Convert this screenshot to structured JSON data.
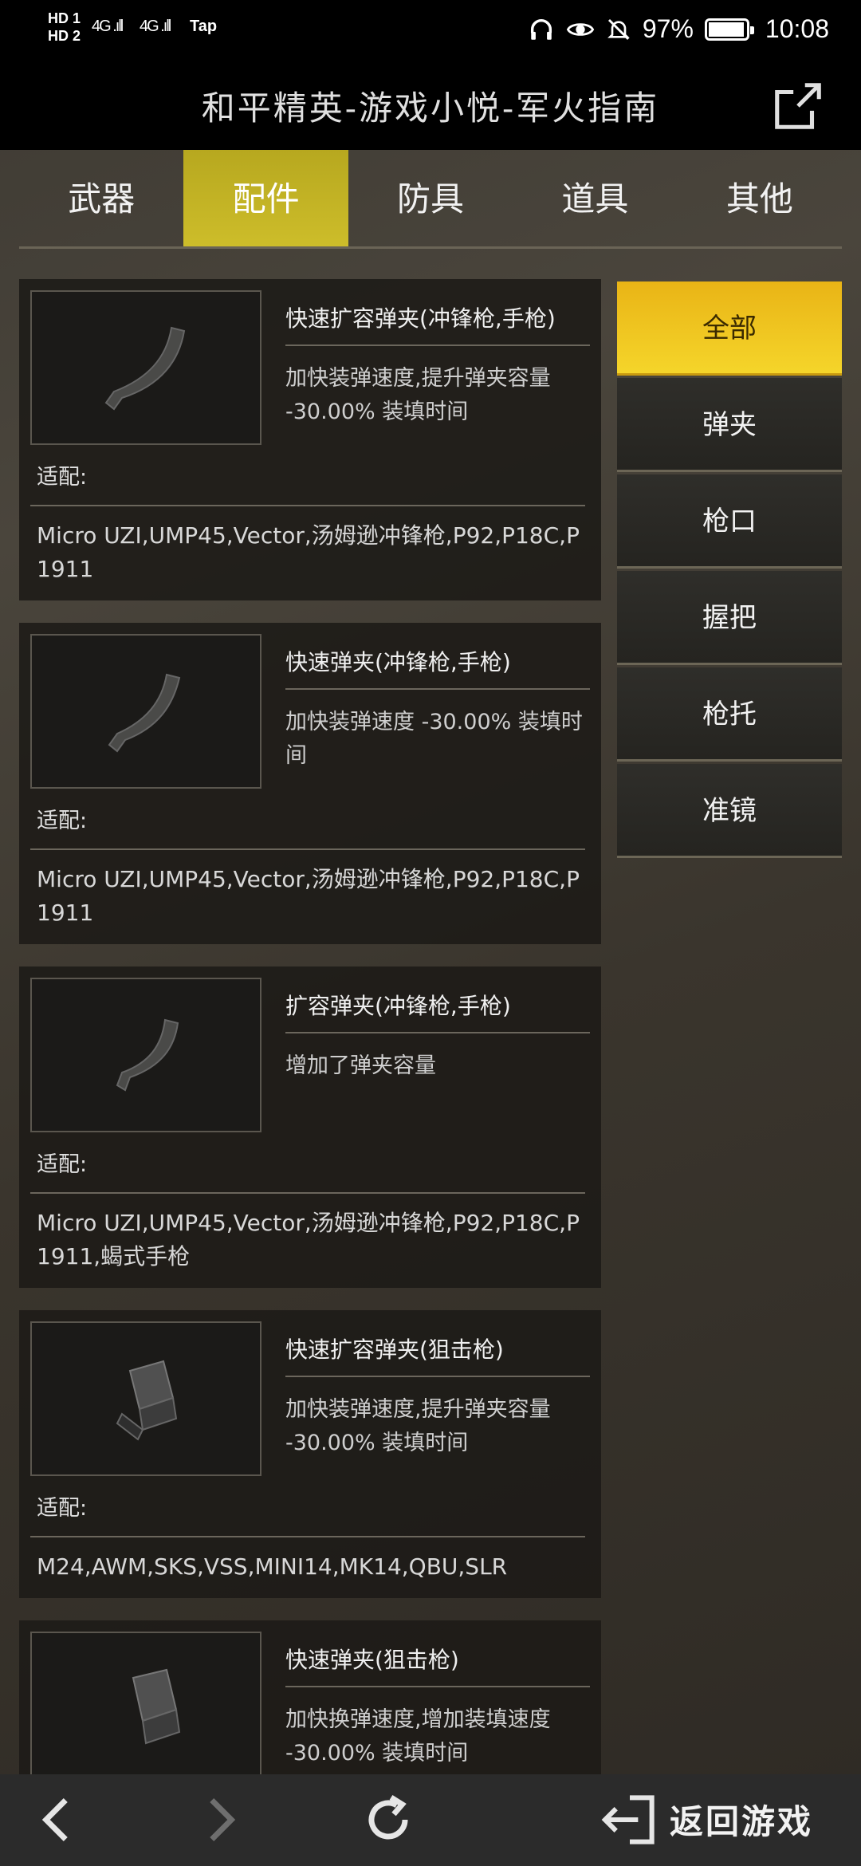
{
  "status_bar": {
    "hd1": "HD 1",
    "hd2": "HD 2",
    "signal1": "4G .ıll",
    "signal2": "4G .ıll",
    "tap": "Tap",
    "battery": "97%",
    "time": "10:08",
    "icons": [
      "headphones-icon",
      "eye-icon",
      "bell-off-icon",
      "battery-icon"
    ]
  },
  "header": {
    "title": "和平精英-游戏小悦-军火指南",
    "share_icon": "share-icon"
  },
  "tabs": [
    {
      "label": "武器",
      "active": false
    },
    {
      "label": "配件",
      "active": true
    },
    {
      "label": "防具",
      "active": false
    },
    {
      "label": "道具",
      "active": false
    },
    {
      "label": "其他",
      "active": false
    }
  ],
  "filters": [
    {
      "label": "全部",
      "active": true
    },
    {
      "label": "弹夹",
      "active": false
    },
    {
      "label": "枪口",
      "active": false
    },
    {
      "label": "握把",
      "active": false
    },
    {
      "label": "枪托",
      "active": false
    },
    {
      "label": "准镜",
      "active": false
    }
  ],
  "fit_label": "适配:",
  "items": [
    {
      "name": "快速扩容弹夹(冲锋枪,手枪)",
      "desc": "加快装弹速度,提升弹夹容量 -30.00% 装填时间",
      "fits": "Micro UZI,UMP45,Vector,汤姆逊冲锋枪,P92,P18C,P1911",
      "icon": "curved-magazine-icon"
    },
    {
      "name": "快速弹夹(冲锋枪,手枪)",
      "desc": "加快装弹速度 -30.00% 装填时间",
      "fits": "Micro UZI,UMP45,Vector,汤姆逊冲锋枪,P92,P18C,P1911",
      "icon": "curved-magazine-icon"
    },
    {
      "name": "扩容弹夹(冲锋枪,手枪)",
      "desc": "增加了弹夹容量",
      "fits": "Micro UZI,UMP45,Vector,汤姆逊冲锋枪,P92,P18C,P1911,蝎式手枪",
      "icon": "curved-magazine-icon"
    },
    {
      "name": "快速扩容弹夹(狙击枪)",
      "desc": "加快装弹速度,提升弹夹容量 -30.00% 装填时间",
      "fits": "M24,AWM,SKS,VSS,MINI14,MK14,QBU,SLR",
      "icon": "box-magazine-icon"
    },
    {
      "name": "快速弹夹(狙击枪)",
      "desc": "加快换弹速度,增加装填速度 -30.00% 装填时间",
      "fits": "",
      "icon": "box-magazine-icon"
    }
  ],
  "bottom_nav": {
    "back_icon": "chevron-left-icon",
    "forward_icon": "chevron-right-icon",
    "refresh_icon": "refresh-icon",
    "return_icon": "return-game-icon",
    "return_label": "返回游戏"
  },
  "colors": {
    "tab_active": "#c9b825",
    "filter_active": "#f0c21f",
    "bar_bg": "#000000",
    "bottom_bg": "#2b2b2b"
  }
}
